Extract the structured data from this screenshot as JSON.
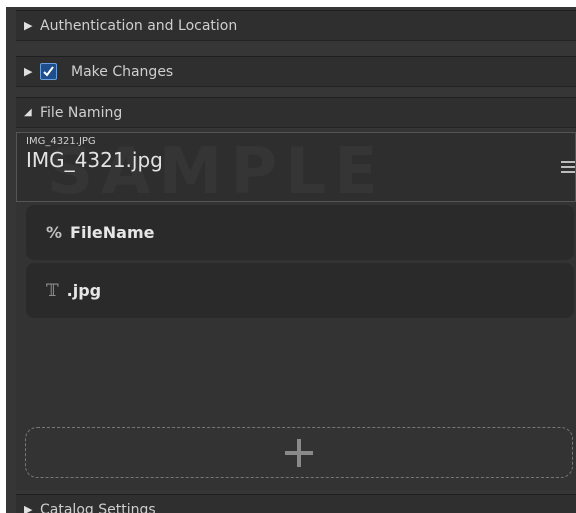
{
  "sections": {
    "auth": {
      "label": "Authentication and Location",
      "expanded": false
    },
    "make_changes": {
      "label": "Make Changes",
      "checked": true,
      "expanded": false
    },
    "file_naming": {
      "label": "File Naming",
      "expanded": true
    },
    "catalog": {
      "label": "Catalog Settings",
      "expanded": false
    }
  },
  "preview": {
    "original_name": "IMG_4321.JPG",
    "new_name": "IMG_4321.jpg",
    "watermark": "SAMPLE"
  },
  "tokens": [
    {
      "icon": "percent-icon",
      "glyph": "%",
      "label": "FileName"
    },
    {
      "icon": "text-icon",
      "glyph": "𝕋",
      "label": ".jpg"
    }
  ],
  "add_button": {
    "icon": "plus-icon"
  },
  "colors": {
    "panel": "#363636",
    "header": "#2f2f2f",
    "token": "#2a2a2a",
    "accent": "#1e4e8c"
  }
}
